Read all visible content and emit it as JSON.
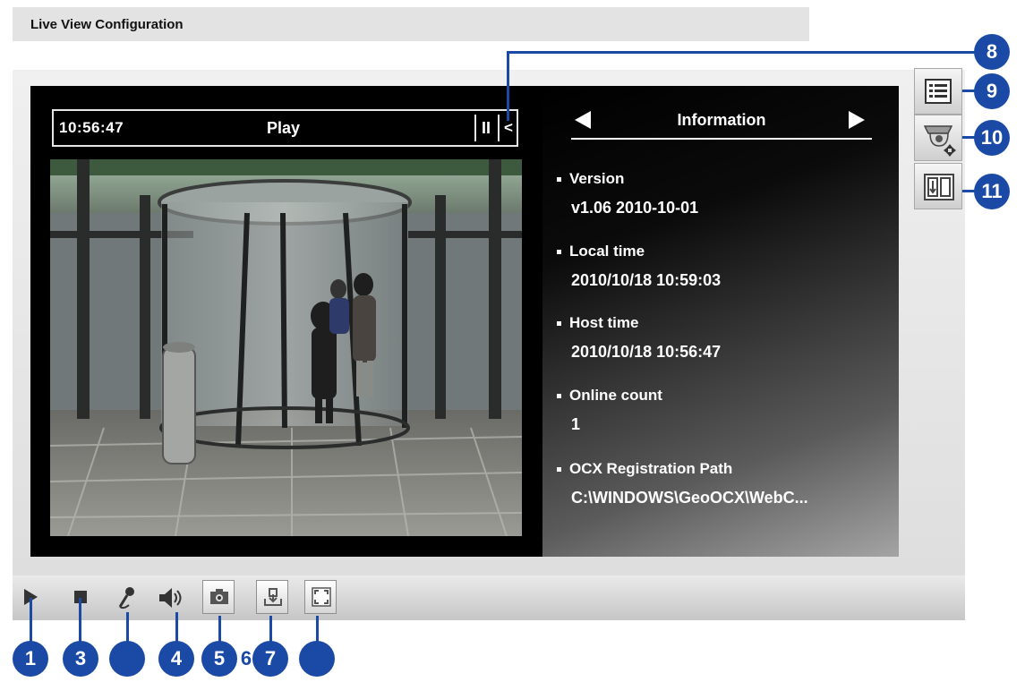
{
  "header": {
    "title": "Live View Configuration"
  },
  "playbar": {
    "time": "10:56:47",
    "state": "Play",
    "pause_label": "II",
    "collapse_label": "<"
  },
  "info_panel": {
    "title": "Information",
    "items": [
      {
        "label": "Version",
        "value": "v1.06  2010-10-01"
      },
      {
        "label": "Local time",
        "value": "2010/10/18 10:59:03"
      },
      {
        "label": "Host time",
        "value": "2010/10/18 10:56:47"
      },
      {
        "label": "Online count",
        "value": "1"
      },
      {
        "label": "OCX Registration Path",
        "value": "C:\\WINDOWS\\GeoOCX\\WebC..."
      }
    ]
  },
  "side_buttons": [
    "list-icon",
    "ptz-camera-icon",
    "io-icon"
  ],
  "toolbar": [
    "play-icon",
    "stop-icon",
    "microphone-icon",
    "speaker-icon",
    "snapshot-icon",
    "save-icon",
    "fullscreen-icon"
  ],
  "callouts": {
    "c1": "1",
    "c3": "3",
    "c4": "4",
    "c5": "5",
    "c6": "6",
    "c7": "7",
    "c8": "8",
    "c9": "9",
    "c10": "10",
    "c11": "11"
  },
  "colors": {
    "callout": "#1a4aa6",
    "stage": "#000000"
  }
}
